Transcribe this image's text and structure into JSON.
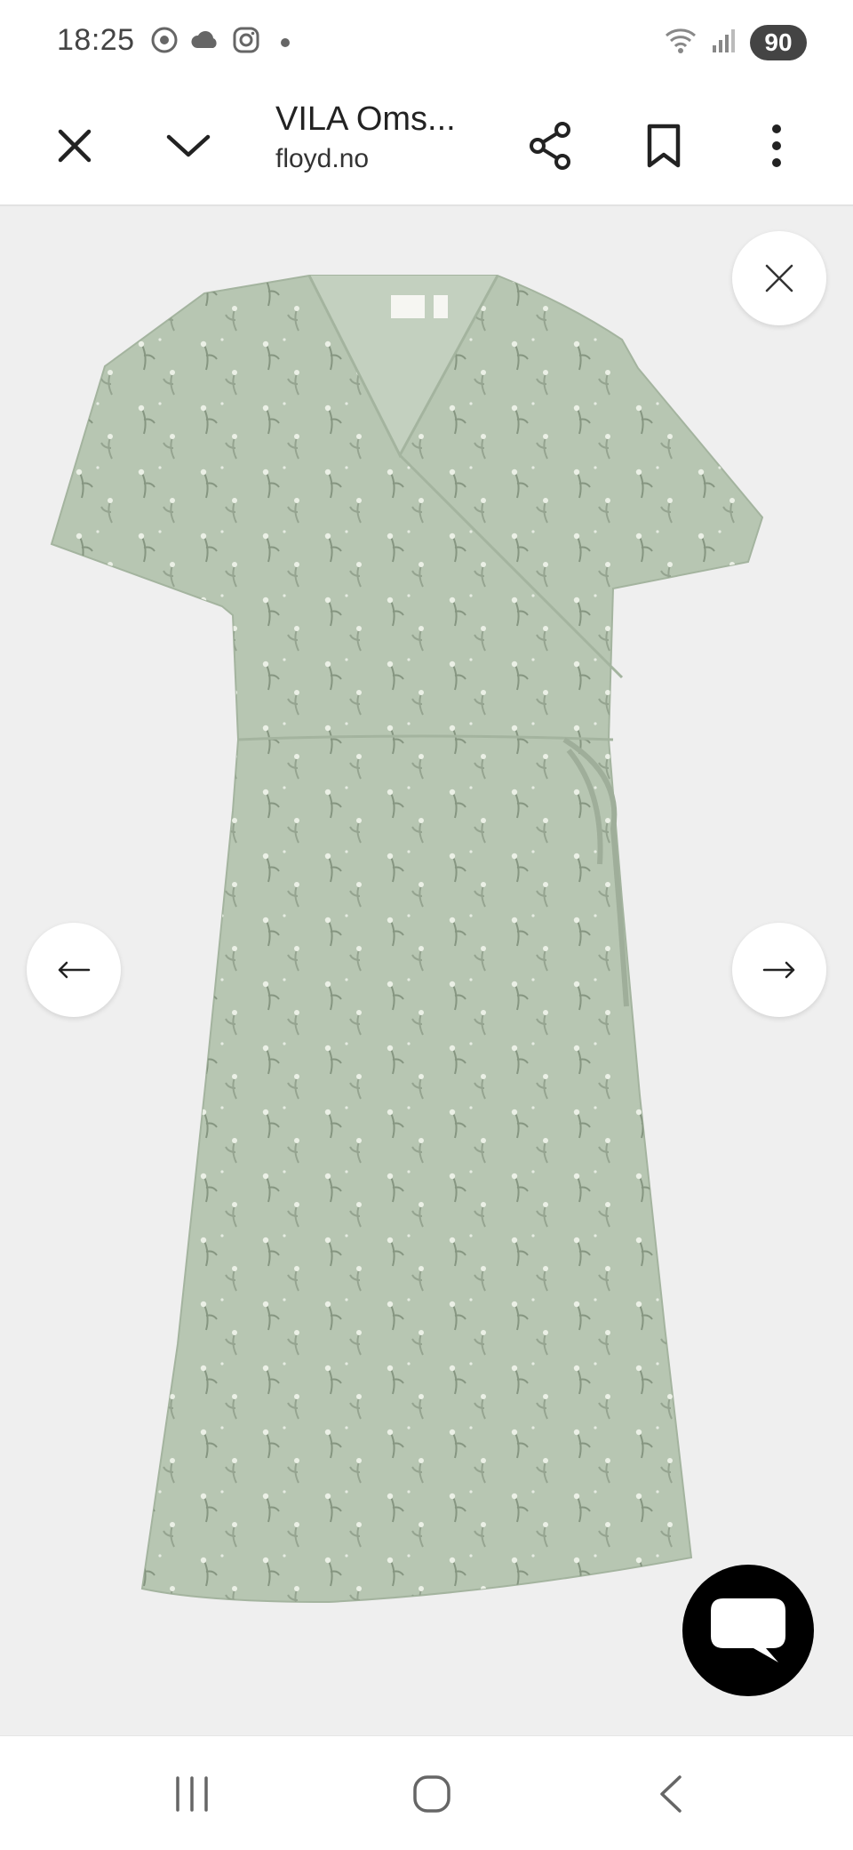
{
  "status_bar": {
    "time": "18:25",
    "icons_left": [
      "chrome-icon",
      "cloud-icon",
      "instagram-icon",
      "dot-icon"
    ],
    "icons_right": [
      "wifi-icon",
      "signal-icon"
    ],
    "battery": "90"
  },
  "toolbar": {
    "title": "VILA Oms...",
    "domain": "floyd.no",
    "buttons": [
      "close-icon",
      "chevron-down-icon",
      "share-icon",
      "bookmark-icon",
      "more-vert-icon"
    ]
  },
  "viewer": {
    "image_alt": "Light green floral wrap dress with short sleeves",
    "dress_color": "#b7c6b2",
    "print_color": "#7d8d78",
    "buttons": [
      "close-icon",
      "arrow-left-icon",
      "arrow-right-icon",
      "chat-icon"
    ]
  },
  "navbar": {
    "buttons": [
      "recent-apps-icon",
      "home-icon",
      "back-icon"
    ]
  }
}
